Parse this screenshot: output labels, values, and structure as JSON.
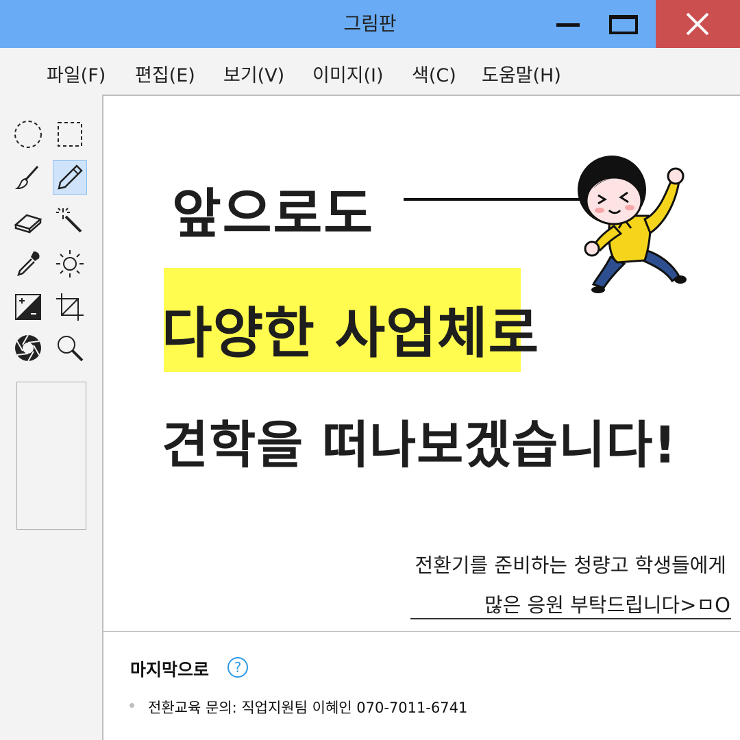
{
  "window": {
    "title": "그림판",
    "min_icon": "minimize-icon",
    "max_icon": "maximize-icon",
    "close_icon": "close-icon",
    "close_color": "#cb4f4f",
    "titlebar_color": "#69acf5"
  },
  "menu": {
    "items": [
      "파일(F)",
      "편집(E)",
      "보기(V)",
      "이미지(I)",
      "색(C)",
      "도움말(H)"
    ]
  },
  "tools": {
    "icons": [
      "free-select-icon",
      "rect-select-icon",
      "brush-icon",
      "pencil-icon",
      "eraser-icon",
      "magic-wand-icon",
      "eyedropper-icon",
      "brightness-icon",
      "exposure-icon",
      "crop-icon",
      "aperture-icon",
      "magnifier-icon"
    ],
    "active": "pencil-icon"
  },
  "canvas": {
    "line1": "앞으로도",
    "line2": "다양한 사업체로",
    "line3": "견학을 떠나보겠습니다!",
    "highlight_color": "#fffb4f",
    "sub1": "전환기를 준비하는 청량고 학생들에게",
    "sub2": "많은 응원 부탁드립니다>ㅁO",
    "footer_title": "마지막으로",
    "help_icon": "question-circle-icon",
    "footer_line": "전환교육 문의: 직업지원팀 이혜인 070-7011-6741"
  }
}
